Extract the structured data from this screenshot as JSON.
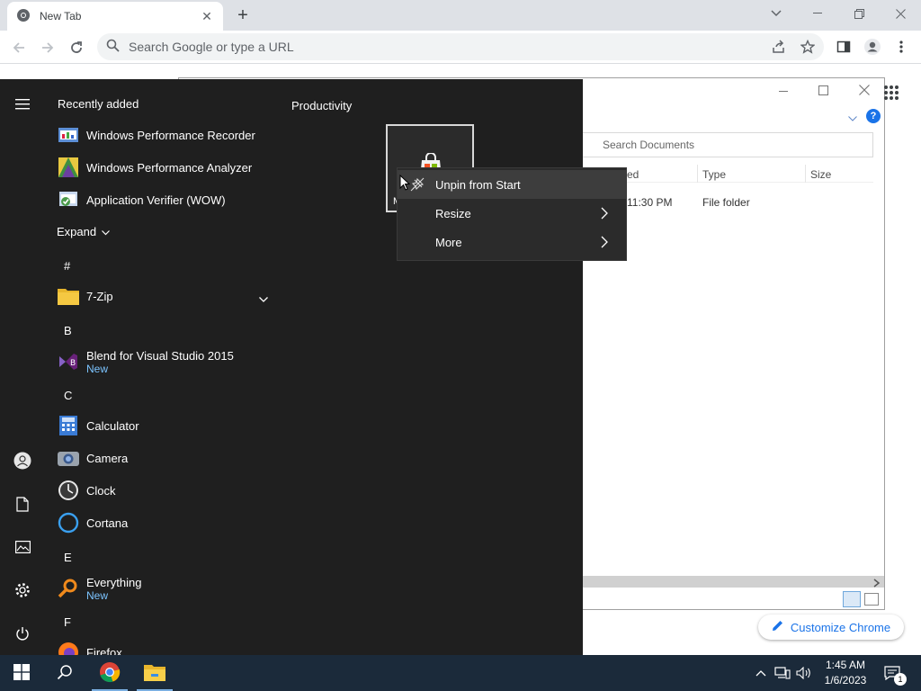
{
  "browser": {
    "tab_title": "New Tab",
    "tab_close": "✕",
    "new_tab": "+",
    "omnibox_placeholder": "Search Google or type a URL",
    "customize_label": "Customize Chrome"
  },
  "explorer": {
    "search_placeholder": "Search Documents",
    "columns": [
      "ed",
      "Type",
      "Size"
    ],
    "row": {
      "modified": "11:30 PM",
      "type": "File folder"
    },
    "help": "?"
  },
  "start_menu": {
    "recently_added_label": "Recently added",
    "recent_apps": [
      {
        "name": "Windows Performance Recorder",
        "icon": "wpr-icon"
      },
      {
        "name": "Windows Performance Analyzer",
        "icon": "wpa-icon"
      },
      {
        "name": "Application Verifier (WOW)",
        "icon": "appverifier-icon"
      }
    ],
    "expand_label": "Expand",
    "groups": [
      {
        "letter": "#",
        "apps": [
          {
            "name": "7-Zip",
            "icon": "folder-icon",
            "expandable": true
          }
        ]
      },
      {
        "letter": "B",
        "apps": [
          {
            "name": "Blend for Visual Studio 2015",
            "sub": "New",
            "icon": "blend-icon"
          }
        ]
      },
      {
        "letter": "C",
        "apps": [
          {
            "name": "Calculator",
            "icon": "calculator-icon"
          },
          {
            "name": "Camera",
            "icon": "camera-icon"
          },
          {
            "name": "Clock",
            "icon": "clock-icon"
          },
          {
            "name": "Cortana",
            "icon": "cortana-icon"
          }
        ]
      },
      {
        "letter": "E",
        "apps": [
          {
            "name": "Everything",
            "sub": "New",
            "icon": "everything-icon"
          }
        ]
      },
      {
        "letter": "F",
        "apps": [
          {
            "name": "Firefox",
            "icon": "firefox-icon"
          }
        ]
      }
    ],
    "productivity_label": "Productivity",
    "tile_label_partial": "M"
  },
  "context_menu": {
    "items": [
      {
        "label": "Unpin from Start",
        "has_submenu": false
      },
      {
        "label": "Resize",
        "has_submenu": true
      },
      {
        "label": "More",
        "has_submenu": true
      }
    ]
  },
  "taskbar": {
    "time": "1:45 AM",
    "date": "1/6/2023",
    "notification_count": "1"
  },
  "colors": {
    "start_bg": "#1f1f1f",
    "taskbar_bg": "#1b2a3a",
    "accent": "#1a73e8",
    "new_badge": "#7cc4ff"
  }
}
